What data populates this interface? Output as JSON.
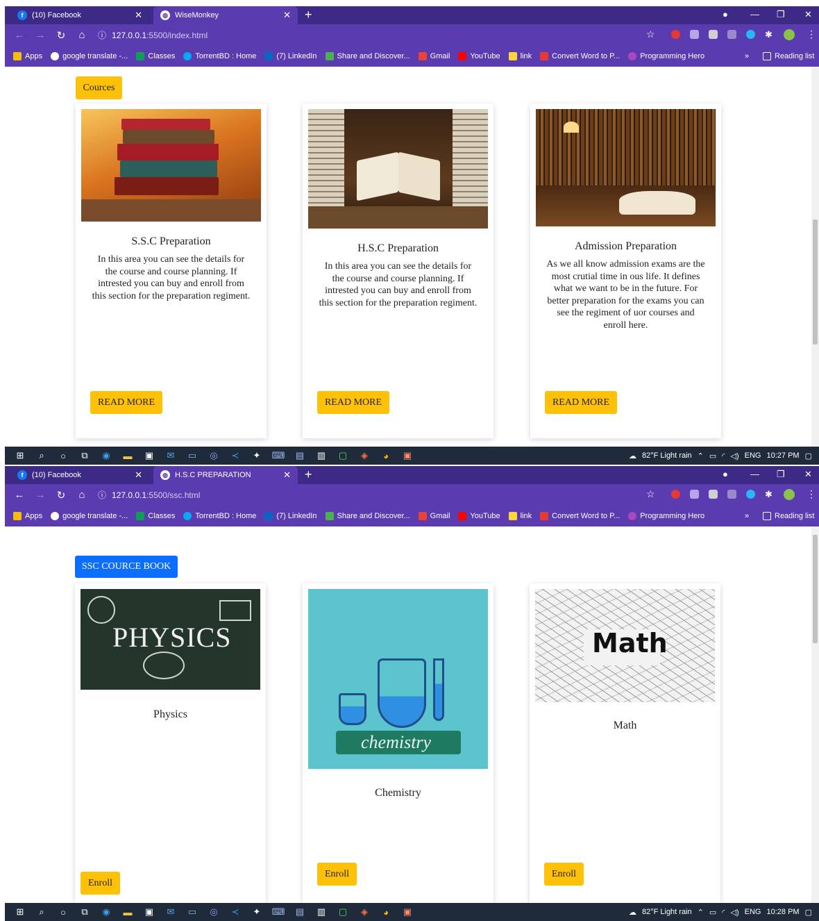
{
  "screens": [
    {
      "tabs": [
        {
          "title": "(10) Facebook",
          "favicon": "facebook-icon"
        },
        {
          "title": "WiseMonkey",
          "favicon": "globe-icon",
          "active": true
        }
      ],
      "url": {
        "host": "127.0.0.1",
        "path": ":5500/index.html"
      },
      "section_button": "Cources",
      "cards": [
        {
          "title": "S.S.C Preparation",
          "text": "In this area you can see the details for the course and course planning. If intrested you can buy and enroll from this section for the preparation regiment.",
          "button": "READ MORE",
          "image": "stacked-books-image"
        },
        {
          "title": "H.S.C Preparation",
          "text": "In this area you can see the details for the course and course planning. If intrested you can buy and enroll from this section for the preparation regiment.",
          "button": "READ MORE",
          "image": "open-book-library-image"
        },
        {
          "title": "Admission Preparation",
          "text": "As we all know admission exams are the most crutial time in ous life. It defines what we want to be in the future. For better preparation for the exams you can see the regiment of uor courses and enroll here.",
          "button": "READ MORE",
          "image": "library-desk-image"
        }
      ],
      "taskbar": {
        "weather": "82°F  Light rain",
        "lang": "ENG",
        "time": "10:27 PM"
      }
    },
    {
      "tabs": [
        {
          "title": "(10) Facebook",
          "favicon": "facebook-icon"
        },
        {
          "title": "H.S.C PREPARATION",
          "favicon": "globe-icon",
          "active": true
        }
      ],
      "url": {
        "host": "127.0.0.1",
        "path": ":5500/ssc.html"
      },
      "section_button": "SSC COURCE BOOK",
      "cards": [
        {
          "title": "Physics",
          "button": "Enroll",
          "image": "physics-chalkboard-image",
          "image_text": "PHYSICS"
        },
        {
          "title": "Chemistry",
          "button": "Enroll",
          "image": "chemistry-flask-image",
          "image_text": "chemistry"
        },
        {
          "title": "Math",
          "button": "Enroll",
          "image": "math-formulas-image",
          "image_text": "Math"
        }
      ],
      "taskbar": {
        "weather": "82°F  Light rain",
        "lang": "ENG",
        "time": "10:28 PM"
      }
    }
  ],
  "bookmarks": [
    "Apps",
    "google translate -...",
    "Classes",
    "TorrentBD : Home",
    "(7) LinkedIn",
    "Share and Discover...",
    "Gmail",
    "YouTube",
    "link",
    "Convert Word to P...",
    "Programming Hero"
  ],
  "bookmarks_overflow": "»",
  "reading_list": "Reading list",
  "colors": {
    "browser_frame": "#3c2a86",
    "toolbar": "#5b3bb0",
    "yellow_button": "#ffc107",
    "blue_button": "#0d6efd",
    "taskbar": "#1f2a3a"
  }
}
